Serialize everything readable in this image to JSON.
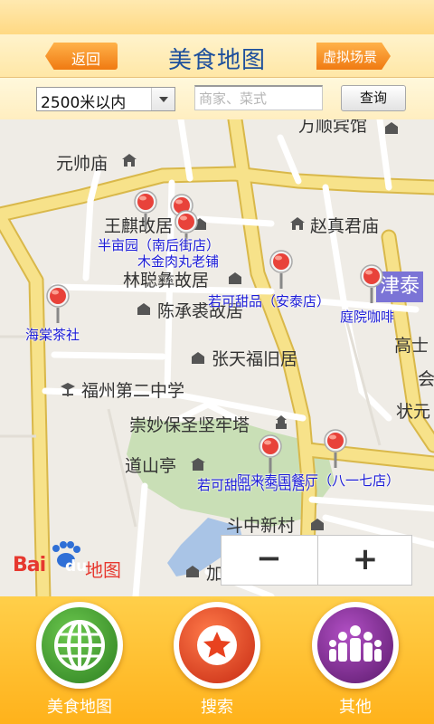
{
  "header": {
    "back_label": "返回",
    "title": "美食地图",
    "virtual_scene_label": "虚拟场景"
  },
  "search": {
    "distance_value": "2500米以内",
    "query_placeholder": "商家、菜式",
    "query_button": "查询"
  },
  "map": {
    "places": [
      "万顺宾馆",
      "元帅庙",
      "王麒故居",
      "赵真君庙",
      "林聪彝故居",
      "陈承裘故居",
      "张天福旧居",
      "福州第二中学",
      "崇妙保圣坚牢塔",
      "道山亭",
      "斗中新村",
      "高士",
      "会",
      "状元",
      "加"
    ],
    "district_badge": "津泰",
    "restaurant_labels": [
      "半亩园（南后街店）",
      "木金肉丸老铺",
      "若可甜品（安泰店）",
      "庭院咖啡",
      "海棠茶社",
      "若可甜品（乌山店）",
      "阿来泰国餐厅（八一七店）"
    ],
    "logo_text_latin": "Bai",
    "logo_text_du": "du",
    "logo_text_cn": "地图",
    "zoom_out_label": "−",
    "zoom_in_label": "+"
  },
  "bottom_nav": [
    {
      "label": "美食地图",
      "icon": "globe-icon",
      "color": "#3d9b2e"
    },
    {
      "label": "搜索",
      "icon": "star-icon",
      "color": "#e8421f"
    },
    {
      "label": "其他",
      "icon": "people-icon",
      "color": "#7a2a8c"
    }
  ],
  "colors": {
    "accent_orange": "#f07a12",
    "title_blue": "#1d4f9c",
    "marker_red": "#e8423a",
    "restaurant_label_blue": "#1c1cd8",
    "road_yellow": "#f7e28a"
  }
}
